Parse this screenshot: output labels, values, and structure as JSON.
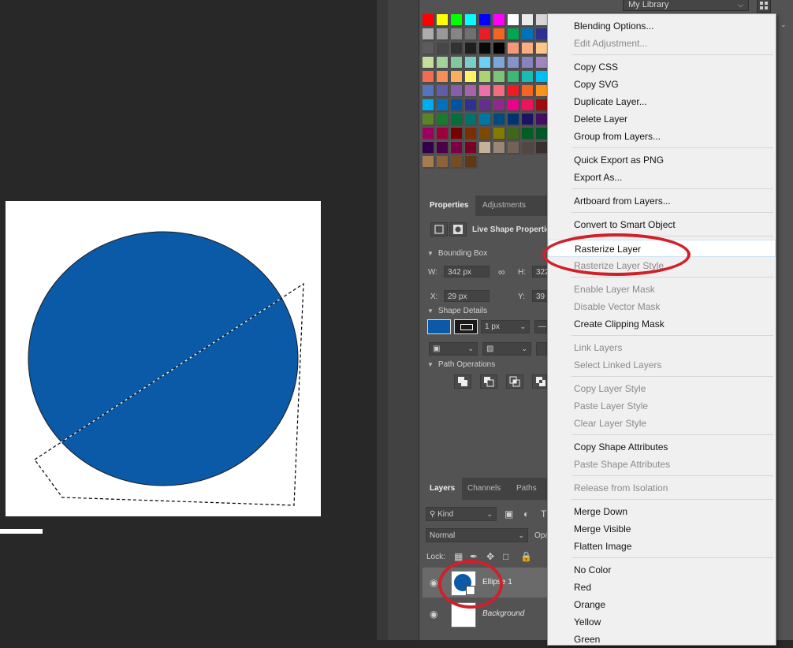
{
  "libraries": {
    "dropdown_value": "My Library"
  },
  "properties": {
    "tabs": [
      "Properties",
      "Adjustments"
    ],
    "header_label": "Live Shape Properties",
    "bounding_box": {
      "title": "Bounding Box",
      "w_label": "W:",
      "w_value": "342 px",
      "h_label": "H:",
      "h_value": "322",
      "x_label": "X:",
      "x_value": "29 px",
      "y_label": "Y:",
      "y_value": "39"
    },
    "shape_details": {
      "title": "Shape Details",
      "stroke_width": "1 px",
      "fill_color": "#0b5aa8"
    },
    "path_operations": {
      "title": "Path Operations"
    }
  },
  "layers": {
    "tabs": [
      "Layers",
      "Channels",
      "Paths"
    ],
    "filter_kind": "Kind",
    "blend_mode": "Normal",
    "opacity_label": "Opa",
    "lock_label": "Lock:",
    "items": [
      {
        "name": "Ellipse 1",
        "visible": true,
        "selected": true
      },
      {
        "name": "Background",
        "visible": true,
        "selected": false
      }
    ]
  },
  "context_menu": {
    "items": [
      {
        "label": "Blending Options...",
        "enabled": true
      },
      {
        "label": "Edit Adjustment...",
        "enabled": false
      },
      {
        "label": "Copy CSS",
        "enabled": true
      },
      {
        "label": "Copy SVG",
        "enabled": true
      },
      {
        "label": "Duplicate Layer...",
        "enabled": true
      },
      {
        "label": "Delete Layer",
        "enabled": true
      },
      {
        "label": "Group from Layers...",
        "enabled": true
      },
      {
        "label": "Quick Export as PNG",
        "enabled": true
      },
      {
        "label": "Export As...",
        "enabled": true
      },
      {
        "label": "Artboard from Layers...",
        "enabled": true
      },
      {
        "label": "Convert to Smart Object",
        "enabled": true
      },
      {
        "label": "Rasterize Layer",
        "enabled": true,
        "highlighted": true
      },
      {
        "label": "Rasterize Layer Style",
        "enabled": false
      },
      {
        "label": "Enable Layer Mask",
        "enabled": false
      },
      {
        "label": "Disable Vector Mask",
        "enabled": false
      },
      {
        "label": "Create Clipping Mask",
        "enabled": true
      },
      {
        "label": "Link Layers",
        "enabled": false
      },
      {
        "label": "Select Linked Layers",
        "enabled": false
      },
      {
        "label": "Copy Layer Style",
        "enabled": false
      },
      {
        "label": "Paste Layer Style",
        "enabled": false
      },
      {
        "label": "Clear Layer Style",
        "enabled": false
      },
      {
        "label": "Copy Shape Attributes",
        "enabled": true
      },
      {
        "label": "Paste Shape Attributes",
        "enabled": false
      },
      {
        "label": "Release from Isolation",
        "enabled": false
      },
      {
        "label": "Merge Down",
        "enabled": true
      },
      {
        "label": "Merge Visible",
        "enabled": true
      },
      {
        "label": "Flatten Image",
        "enabled": true
      },
      {
        "label": "No Color",
        "enabled": true
      },
      {
        "label": "Red",
        "enabled": true
      },
      {
        "label": "Orange",
        "enabled": true
      },
      {
        "label": "Yellow",
        "enabled": true
      },
      {
        "label": "Green",
        "enabled": true
      }
    ]
  },
  "colors": {
    "ellipse_fill": "#0b5aa8",
    "annotation": "#d0202a",
    "panel_bg": "#535353",
    "canvas_bg": "#282828"
  }
}
